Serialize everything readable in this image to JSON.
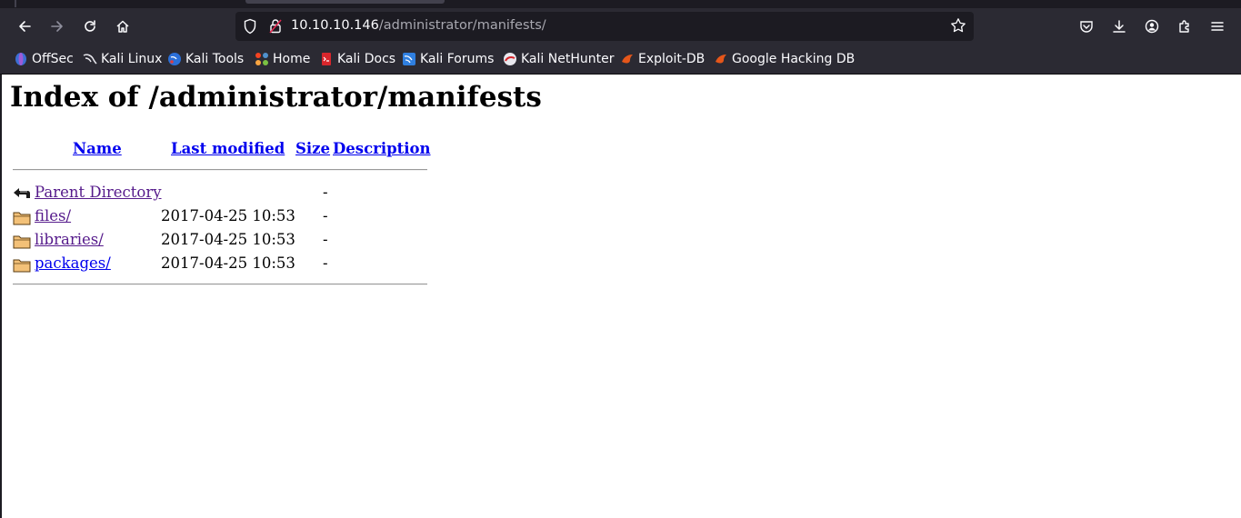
{
  "browser": {
    "url_host": "10.10.10.146",
    "url_path": "/administrator/manifests/"
  },
  "bookmarks": [
    {
      "label": "OffSec",
      "icon": "offsec-icon"
    },
    {
      "label": "Kali Linux",
      "icon": "kali-dragon-icon"
    },
    {
      "label": "Kali Tools",
      "icon": "kali-tools-icon"
    },
    {
      "label": "Home",
      "icon": "joomla-icon"
    },
    {
      "label": "Kali Docs",
      "icon": "kali-docs-icon"
    },
    {
      "label": "Kali Forums",
      "icon": "kali-forums-icon"
    },
    {
      "label": "Kali NetHunter",
      "icon": "nethunter-icon"
    },
    {
      "label": "Exploit-DB",
      "icon": "exploit-db-icon"
    },
    {
      "label": "Google Hacking DB",
      "icon": "ghdb-icon"
    }
  ],
  "page": {
    "title": "Index of /administrator/manifests",
    "columns": {
      "name": "Name",
      "last_modified": "Last modified",
      "size": "Size",
      "description": "Description"
    },
    "rows": [
      {
        "name": "Parent Directory",
        "modified": "",
        "size": "-",
        "icon": "back-arrow-icon"
      },
      {
        "name": "files/",
        "modified": "2017-04-25 10:53",
        "size": "-",
        "icon": "folder-icon"
      },
      {
        "name": "libraries/",
        "modified": "2017-04-25 10:53",
        "size": "-",
        "icon": "folder-icon"
      },
      {
        "name": "packages/",
        "modified": "2017-04-25 10:53",
        "size": "-",
        "icon": "folder-icon"
      }
    ]
  },
  "colors": {
    "link": "#0000ee",
    "visited": "#551a8b",
    "toolbar": "#2b2a33",
    "urlbar": "#1c1b22"
  }
}
